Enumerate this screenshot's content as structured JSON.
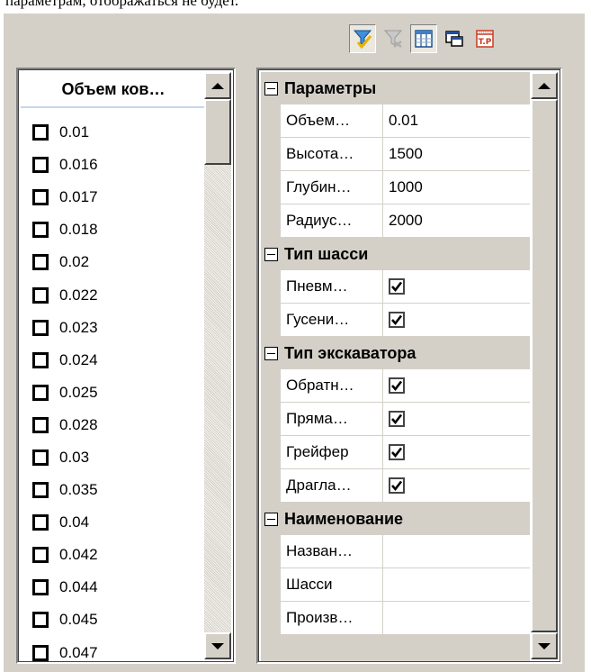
{
  "header_text": "параметрам, отображаться не будет.",
  "toolbar": {
    "buttons": [
      {
        "icon": "filter-icon",
        "pressed": true
      },
      {
        "icon": "filter-clear-icon",
        "pressed": false
      },
      {
        "icon": "columns-icon",
        "pressed": true
      },
      {
        "icon": "window-view-icon",
        "pressed": false
      },
      {
        "icon": "tp-report-icon",
        "pressed": false
      }
    ]
  },
  "list": {
    "header": "Объем ков…",
    "items": [
      "0.01",
      "0.016",
      "0.017",
      "0.018",
      "0.02",
      "0.022",
      "0.023",
      "0.024",
      "0.025",
      "0.028",
      "0.03",
      "0.035",
      "0.04",
      "0.042",
      "0.044",
      "0.045",
      "0.047"
    ]
  },
  "grid": {
    "categories": [
      {
        "label": "Параметры",
        "rows": [
          {
            "name": "Объем…",
            "value": "0.01",
            "checkbox": false
          },
          {
            "name": "Высота…",
            "value": "1500",
            "checkbox": false
          },
          {
            "name": "Глубин…",
            "value": "1000",
            "checkbox": false
          },
          {
            "name": "Радиус…",
            "value": "2000",
            "checkbox": false
          }
        ]
      },
      {
        "label": "Тип шасси",
        "rows": [
          {
            "name": "Пневм…",
            "value": "",
            "checkbox": true
          },
          {
            "name": "Гусени…",
            "value": "",
            "checkbox": true
          }
        ]
      },
      {
        "label": "Тип экскаватора",
        "rows": [
          {
            "name": "Обратн…",
            "value": "",
            "checkbox": true
          },
          {
            "name": "Прямa…",
            "value": "",
            "checkbox": true
          },
          {
            "name": "Грейфер",
            "value": "",
            "checkbox": true
          },
          {
            "name": "Драгла…",
            "value": "",
            "checkbox": true
          }
        ]
      },
      {
        "label": "Наименование",
        "rows": [
          {
            "name": "Назван…",
            "value": "",
            "checkbox": false
          },
          {
            "name": "Шасси",
            "value": "",
            "checkbox": false
          },
          {
            "name": "Произв…",
            "value": "",
            "checkbox": false
          }
        ]
      }
    ]
  },
  "colors": {
    "panel": "#d4d0c8",
    "header_underline": "#c7d6ea"
  }
}
